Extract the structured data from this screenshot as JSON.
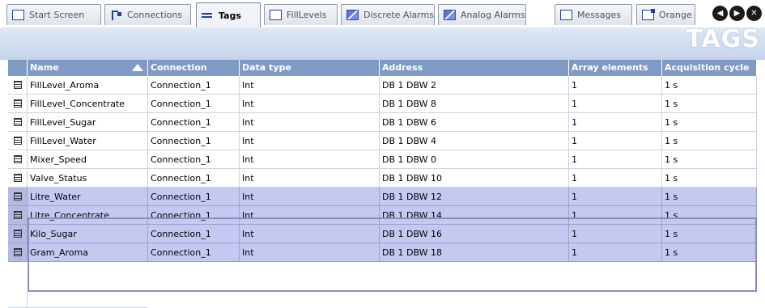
{
  "tabs": [
    {
      "label": "Start Screen",
      "icon": "screen-icon",
      "active": false
    },
    {
      "label": "Connections",
      "icon": "connections-icon",
      "active": false
    },
    {
      "label": "Tags",
      "icon": "tags-icon",
      "active": true
    },
    {
      "label": "FillLevels",
      "icon": "screen-icon",
      "active": false
    },
    {
      "label": "Discrete Alarms",
      "icon": "discrete-alarms-icon",
      "active": false
    },
    {
      "label": "Analog Alarms",
      "icon": "analog-alarms-icon",
      "active": false
    },
    {
      "label": "Messages",
      "icon": "screen-icon",
      "active": false
    },
    {
      "label": "Orange",
      "icon": "document-icon",
      "active": false
    }
  ],
  "nav": {
    "prev": "◀",
    "next": "▶",
    "close": "✕"
  },
  "editor": {
    "watermark": "TAGS"
  },
  "table": {
    "columns": [
      "Name",
      "Connection",
      "Data type",
      "Address",
      "Array elements",
      "Acquisition cycle"
    ],
    "sort": {
      "column": "Name",
      "direction": "ascending"
    },
    "rows": [
      {
        "name": "FillLevel_Aroma",
        "connection": "Connection_1",
        "data_type": "Int",
        "address": "DB 1 DBW 2",
        "array_elements": "1",
        "acquisition_cycle": "1 s",
        "selected": false
      },
      {
        "name": "FillLevel_Concentrate",
        "connection": "Connection_1",
        "data_type": "Int",
        "address": "DB 1 DBW 8",
        "array_elements": "1",
        "acquisition_cycle": "1 s",
        "selected": false
      },
      {
        "name": "FillLevel_Sugar",
        "connection": "Connection_1",
        "data_type": "Int",
        "address": "DB 1 DBW 6",
        "array_elements": "1",
        "acquisition_cycle": "1 s",
        "selected": false
      },
      {
        "name": "FillLevel_Water",
        "connection": "Connection_1",
        "data_type": "Int",
        "address": "DB 1 DBW 4",
        "array_elements": "1",
        "acquisition_cycle": "1 s",
        "selected": false
      },
      {
        "name": "Mixer_Speed",
        "connection": "Connection_1",
        "data_type": "Int",
        "address": "DB 1 DBW 0",
        "array_elements": "1",
        "acquisition_cycle": "1 s",
        "selected": false
      },
      {
        "name": "Valve_Status",
        "connection": "Connection_1",
        "data_type": "Int",
        "address": "DB 1 DBW 10",
        "array_elements": "1",
        "acquisition_cycle": "1 s",
        "selected": false
      },
      {
        "name": "Litre_Water",
        "connection": "Connection_1",
        "data_type": "Int",
        "address": "DB 1 DBW 12",
        "array_elements": "1",
        "acquisition_cycle": "1 s",
        "selected": true
      },
      {
        "name": "Litre_Concentrate",
        "connection": "Connection_1",
        "data_type": "Int",
        "address": "DB 1 DBW 14",
        "array_elements": "1",
        "acquisition_cycle": "1 s",
        "selected": true
      },
      {
        "name": "Kilo_Sugar",
        "connection": "Connection_1",
        "data_type": "Int",
        "address": "DB 1 DBW 16",
        "array_elements": "1",
        "acquisition_cycle": "1 s",
        "selected": true
      },
      {
        "name": "Gram_Aroma",
        "connection": "Connection_1",
        "data_type": "Int",
        "address": "DB 1 DBW 18",
        "array_elements": "1",
        "acquisition_cycle": "1 s",
        "selected": true
      }
    ]
  },
  "colors": {
    "header_bg": "#7f9bc4",
    "selection_bg": "#c5c9f2",
    "banner_top": "#dfe9f6",
    "banner_bottom": "#c4d4ec"
  }
}
